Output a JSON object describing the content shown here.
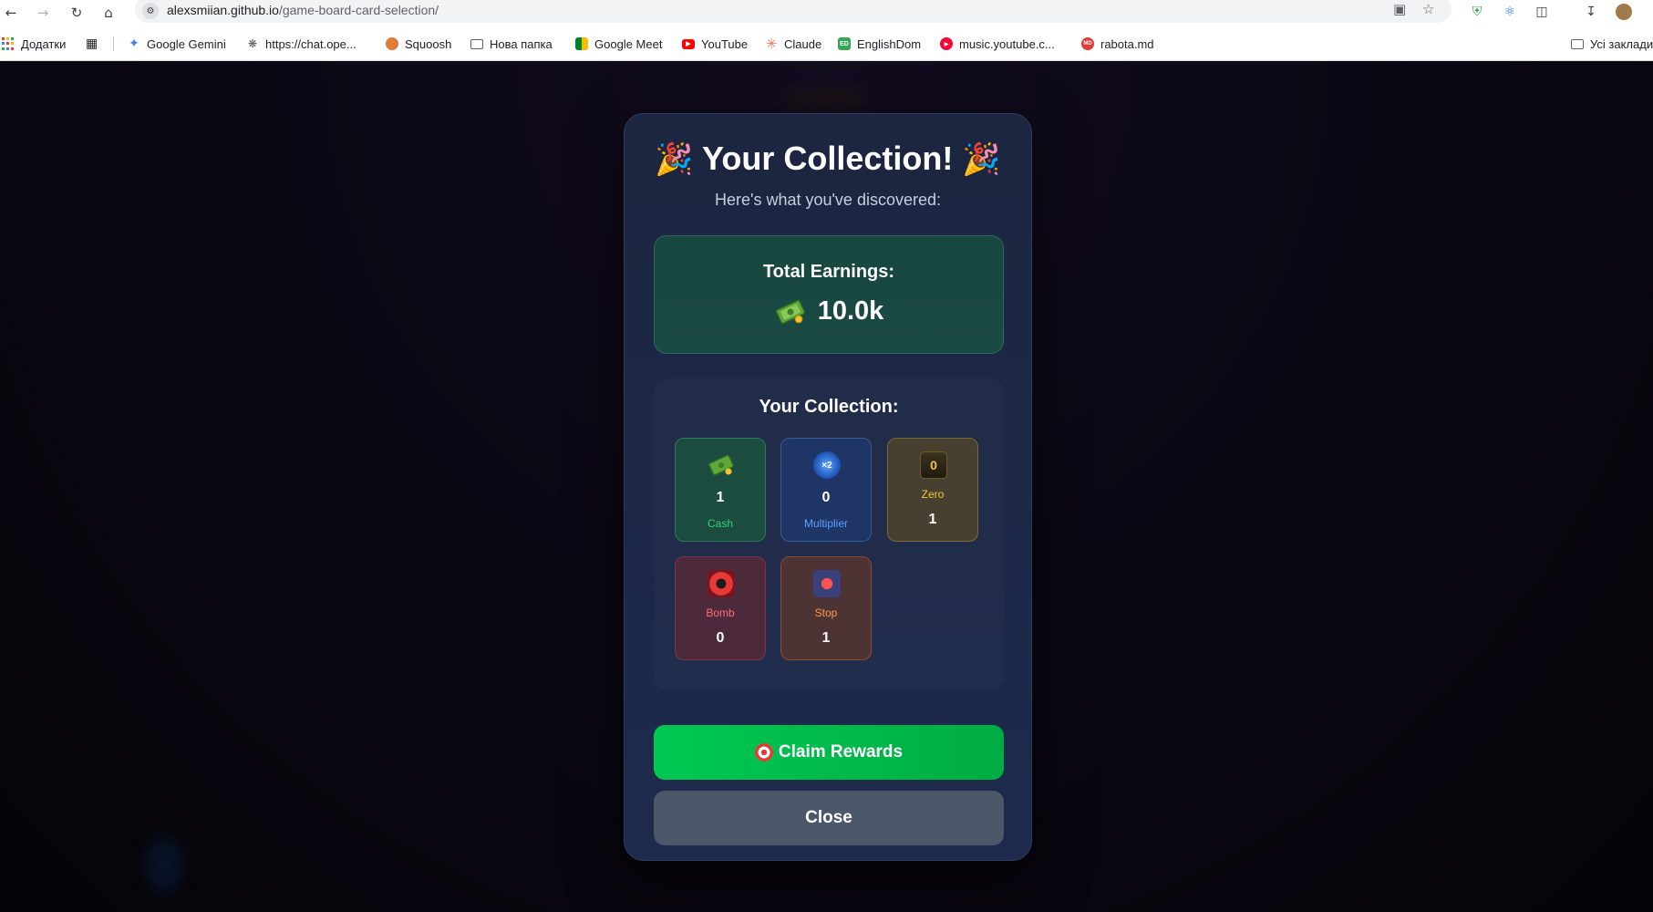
{
  "browser": {
    "url_host": "alexsmiian.github.io",
    "url_path": "/game-board-card-selection/",
    "bookmarks": [
      {
        "label": "Додатки",
        "color": "#4285f4"
      },
      {
        "label": "Google Gemini",
        "color": "#4f7cf6"
      },
      {
        "label": "https://chat.ope...",
        "color": "#555555"
      },
      {
        "label": "Squoosh",
        "color": "#e07b39"
      },
      {
        "label": "Нова папка",
        "color": "#5f6368"
      },
      {
        "label": "Google Meet",
        "color": "#00897b"
      },
      {
        "label": "YouTube",
        "color": "#ff0000"
      },
      {
        "label": "Claude",
        "color": "#d97757"
      },
      {
        "label": "EnglishDom",
        "color": "#34a853"
      },
      {
        "label": "music.youtube.c...",
        "color": "#ff0033"
      },
      {
        "label": "rabota.md",
        "color": "#e53935"
      }
    ],
    "all_bookmarks": "Усі заклади"
  },
  "modal": {
    "title": "Your Collection!",
    "subtitle": "Here's what you've discovered:",
    "earnings_label": "Total Earnings:",
    "earnings_value": "10.0k",
    "collection_title": "Your Collection:",
    "cards": {
      "cash": {
        "count": "1",
        "label": "Cash",
        "color": "#35d07f"
      },
      "multiplier": {
        "count": "0",
        "label": "Multiplier",
        "color": "#5aa0ff",
        "badge": "×2"
      },
      "zero": {
        "count": "1",
        "label": "Zero",
        "color": "#f2c83a",
        "badge": "0"
      },
      "bomb": {
        "count": "0",
        "label": "Bomb",
        "color": "#ff6b7d"
      },
      "stop": {
        "count": "1",
        "label": "Stop",
        "color": "#ff9a4a"
      }
    },
    "claim_label": "Claim Rewards",
    "close_label": "Close"
  }
}
